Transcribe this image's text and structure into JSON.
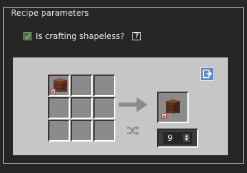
{
  "section": {
    "title": "Recipe parameters"
  },
  "shapeless": {
    "label": "Is crafting shapeless?",
    "checked": true,
    "help": "?"
  },
  "grid": {
    "slots": [
      {
        "item": "nether-brick-block",
        "missing_texture_badge": true
      },
      {
        "item": null
      },
      {
        "item": null
      },
      {
        "item": null
      },
      {
        "item": null
      },
      {
        "item": null
      },
      {
        "item": null
      },
      {
        "item": null
      },
      {
        "item": null
      }
    ]
  },
  "result": {
    "item": "nether-brick-block",
    "missing_texture_badge": true,
    "count": "9"
  },
  "icons": {
    "checkbox": "checkmark-icon",
    "help": "question-icon",
    "export": "export-icon",
    "arrow": "arrow-right-icon",
    "shuffle": "shuffle-icon",
    "stepper": "stepper-icon"
  },
  "colors": {
    "background": "#262626",
    "panel": "#c6c6c6",
    "slot": "#8b8b8b",
    "accent": "#5a88c9",
    "check": "#7fc241"
  }
}
